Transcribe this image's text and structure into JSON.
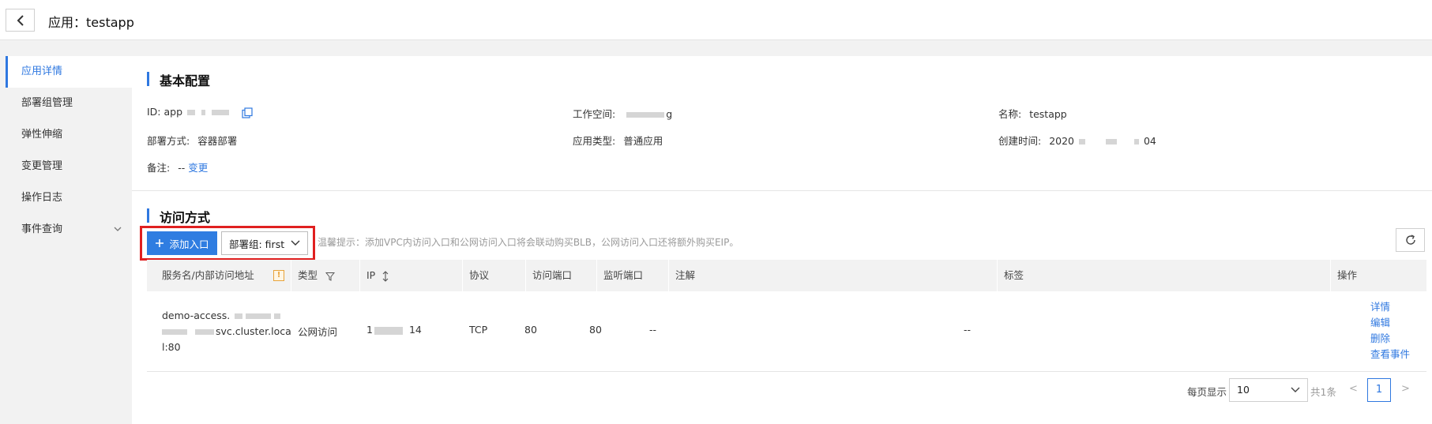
{
  "header": {
    "title": "应用：testapp"
  },
  "sidebar": {
    "items": [
      {
        "label": "应用详情"
      },
      {
        "label": "部署组管理"
      },
      {
        "label": "弹性伸缩"
      },
      {
        "label": "变更管理"
      },
      {
        "label": "操作日志"
      },
      {
        "label": "事件查询"
      }
    ]
  },
  "basic": {
    "title": "基本配置",
    "id_label": "ID:",
    "id_value": "app",
    "workspace_label": "工作空间:",
    "workspace_value": "g",
    "name_label": "名称:",
    "name_value": "testapp",
    "deploy_label": "部署方式:",
    "deploy_value": "容器部署",
    "apptype_label": "应用类型:",
    "apptype_value": "普通应用",
    "created_label": "创建时间:",
    "created_value_a": "2020",
    "created_value_b": "04",
    "note_label": "备注:",
    "note_value": "--",
    "note_link": "变更"
  },
  "access": {
    "title": "访问方式",
    "add_button": "添加入口",
    "group_select": "部署组: first",
    "tip": "温馨提示：添加VPC内访问入口和公网访问入口将会联动购买BLB，公网访问入口还将额外购买EIP。",
    "columns": [
      "服务名/内部访问地址",
      "类型",
      "IP",
      "协议",
      "访问端口",
      "监听端口",
      "注解",
      "标签",
      "操作"
    ],
    "rows": [
      {
        "service_line1": "demo-access.",
        "service_line2": "svc.cluster.loca",
        "service_line3": "l:80",
        "type": "公网访问",
        "ip_a": "1",
        "ip_b": "14",
        "protocol": "TCP",
        "access_port": "80",
        "listen_port": "80",
        "annotation": "--",
        "tags": "--",
        "ops": [
          "详情",
          "编辑",
          "删除",
          "查看事件"
        ]
      }
    ]
  },
  "pagination": {
    "per_page_label": "每页显示",
    "per_page_value": "10",
    "total": "共1条",
    "prev": "<",
    "current": "1",
    "next": ">"
  },
  "colors": {
    "accent": "#2f78e0",
    "highlight": "#e02020"
  }
}
